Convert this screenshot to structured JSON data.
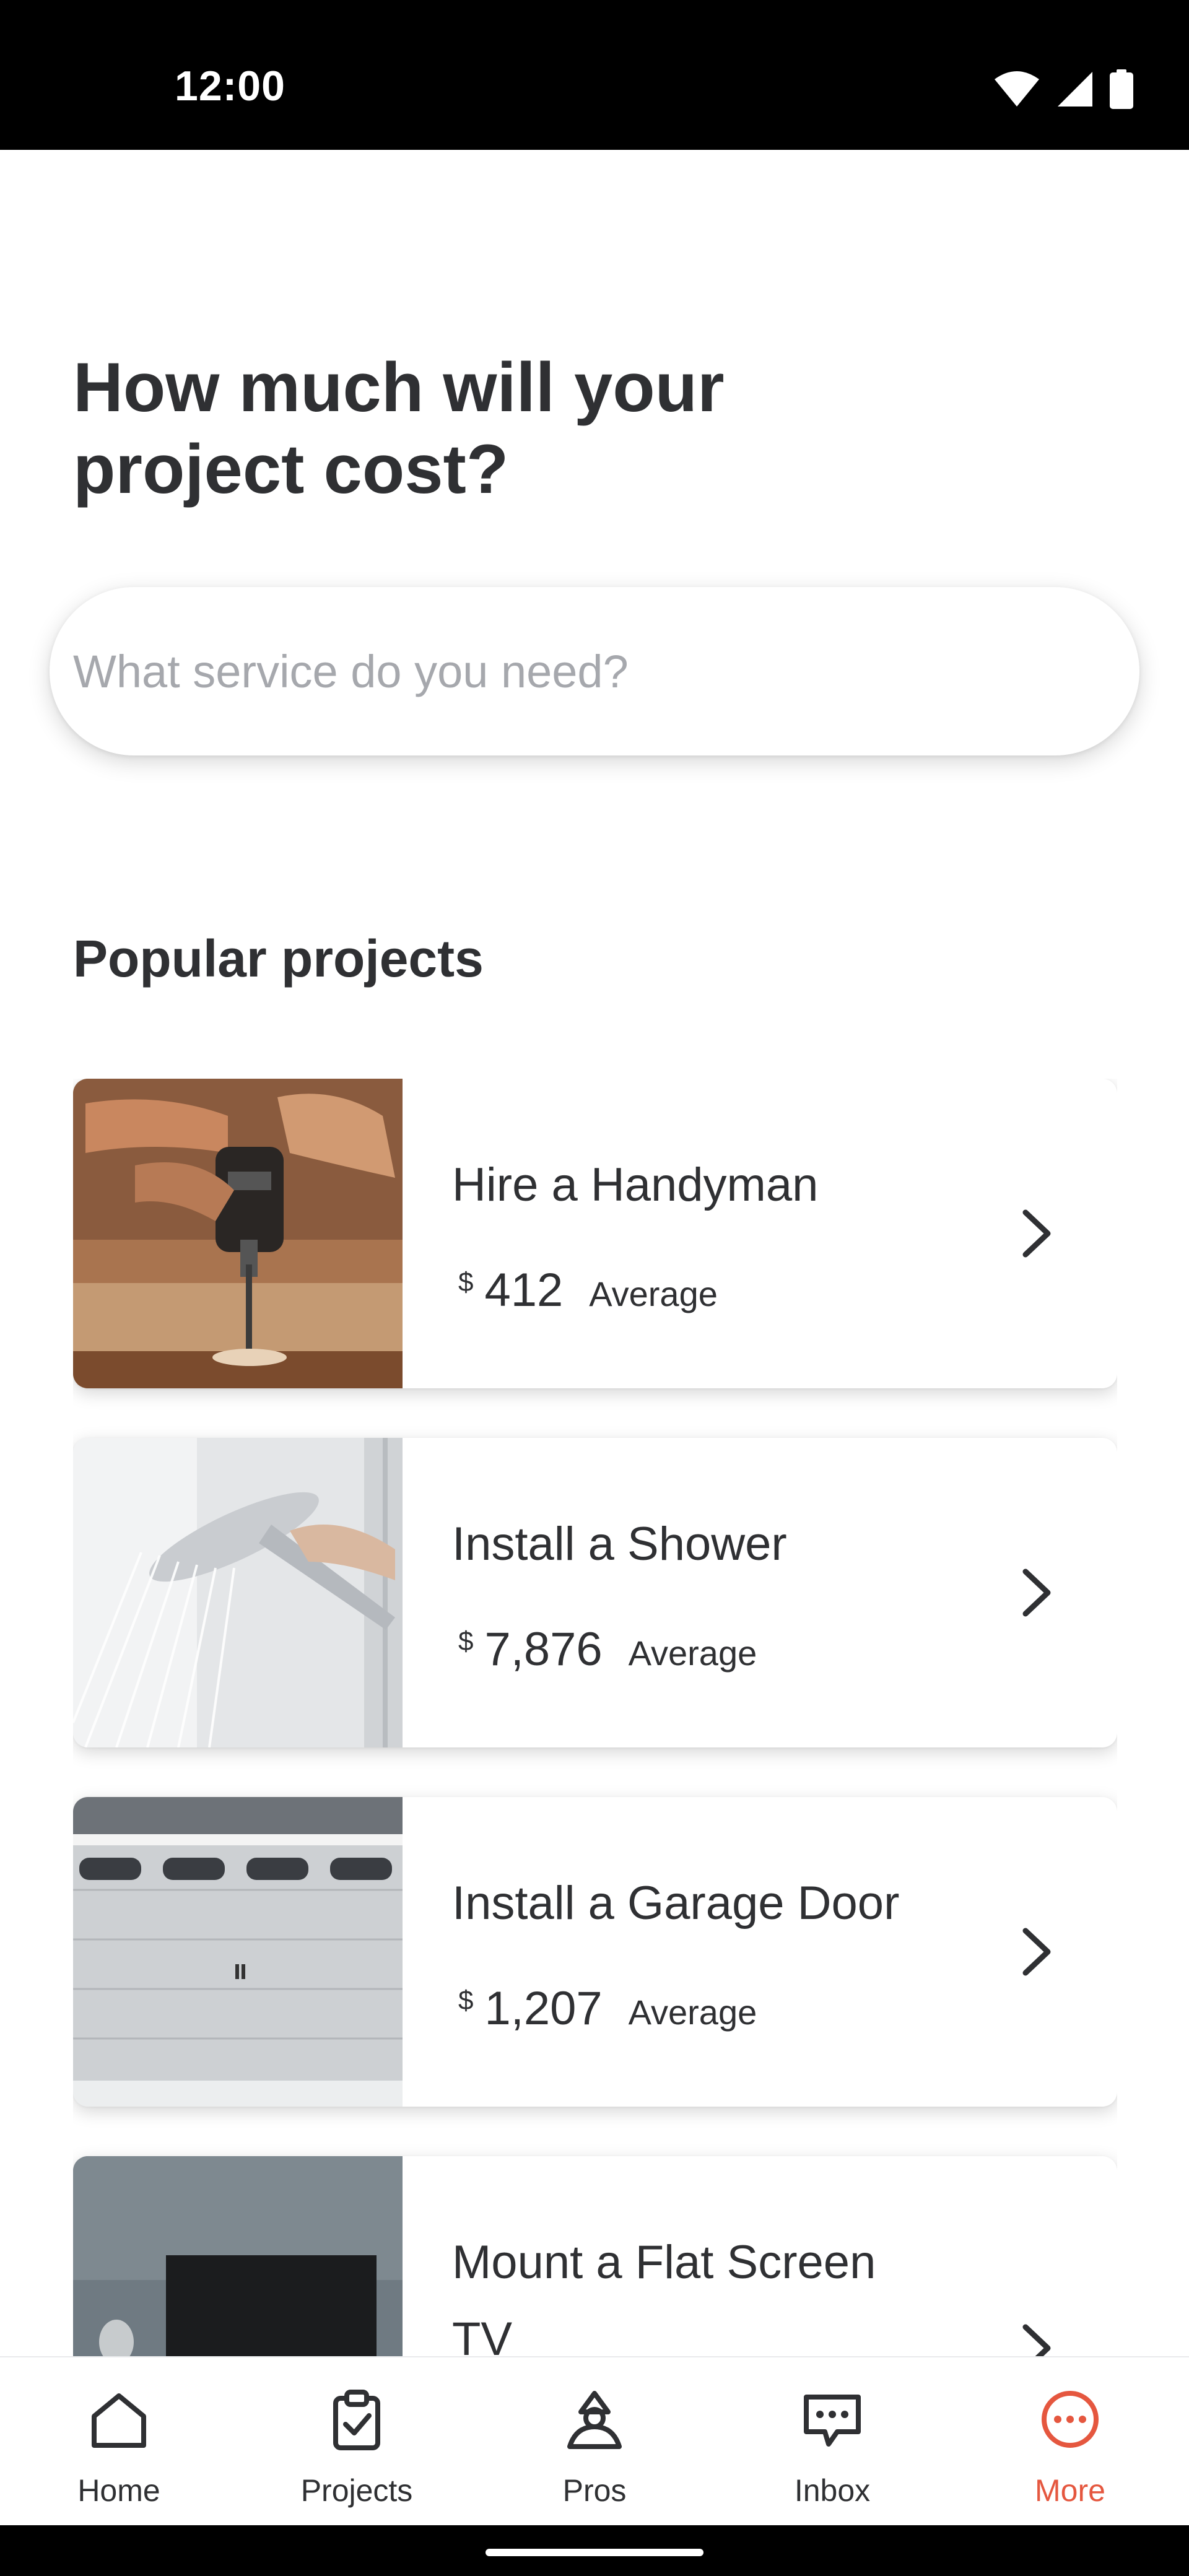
{
  "status_bar": {
    "time": "12:00"
  },
  "header": {
    "title": "How much will your project cost?"
  },
  "search": {
    "placeholder": "What service do you need?"
  },
  "section": {
    "title": "Popular projects"
  },
  "projects": [
    {
      "title": "Hire a Handyman",
      "currency": "$",
      "amount": "412",
      "label": "Average",
      "image": "drill-photo"
    },
    {
      "title": "Install a Shower",
      "currency": "$",
      "amount": "7,876",
      "label": "Average",
      "image": "shower-photo"
    },
    {
      "title": "Install a Garage Door",
      "currency": "$",
      "amount": "1,207",
      "label": "Average",
      "image": "garage-door-photo"
    },
    {
      "title": "Mount a Flat Screen TV",
      "currency": "",
      "amount": "",
      "label": "",
      "image": "tv-photo"
    }
  ],
  "nav": {
    "items": [
      {
        "label": "Home",
        "icon": "home-icon"
      },
      {
        "label": "Projects",
        "icon": "clipboard-check-icon"
      },
      {
        "label": "Pros",
        "icon": "pros-icon"
      },
      {
        "label": "Inbox",
        "icon": "chat-bubble-icon"
      },
      {
        "label": "More",
        "icon": "more-dots-icon"
      }
    ],
    "active": "More",
    "active_color": "#e5573f"
  }
}
